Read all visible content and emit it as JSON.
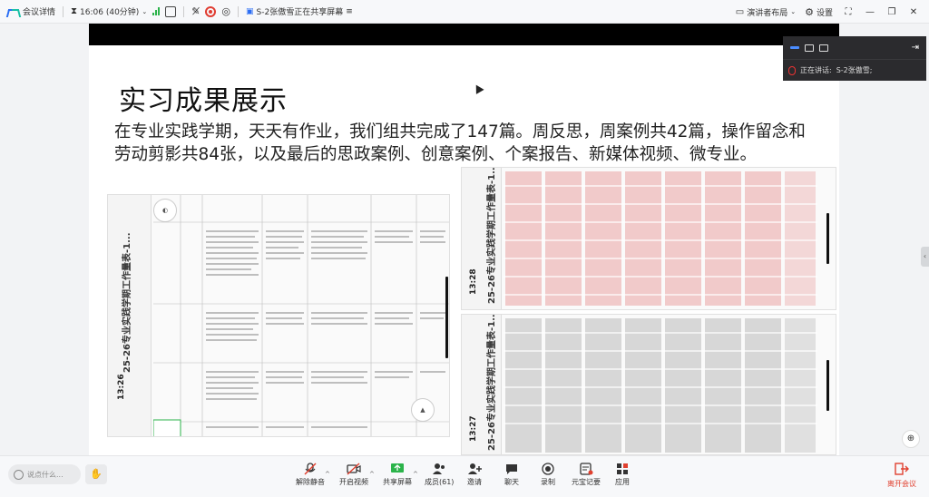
{
  "topbar": {
    "meeting_details": "会议详情",
    "time": "16:06 (40分钟)",
    "share_status": "S-2张傲雪正在共享屏幕",
    "presenter_layout": "演讲者布局",
    "settings": "设置"
  },
  "slide": {
    "title": "实习成果展示",
    "body": "在专业实践学期，天天有作业，我们组共完成了147篇。周反思，周案例共42篇，操作留念和劳动剪影共84张，以及最后的思政案例、创意案例、个案报告、新媒体视频、微专业。",
    "screenshot_left": {
      "title": "25-26专业实践学期工作量表-1...",
      "time": "13:26"
    },
    "screenshot_right_top": {
      "title": "25-26专业实践学期工作量表-1...",
      "time": "13:28"
    },
    "screenshot_right_bottom": {
      "title": "25-26专业实践学期工作量表-1...",
      "time": "13:27"
    }
  },
  "speaker": {
    "label": "正在讲话:",
    "name": "S-2张傲雪;"
  },
  "toolbar": {
    "chat_placeholder": "说点什么...",
    "items": [
      {
        "label": "解除静音",
        "icon": "mic-muted-icon"
      },
      {
        "label": "开启视频",
        "icon": "video-off-icon"
      },
      {
        "label": "共享屏幕",
        "icon": "share-screen-icon"
      },
      {
        "label": "成员(61)",
        "icon": "members-icon"
      },
      {
        "label": "邀请",
        "icon": "invite-icon"
      },
      {
        "label": "聊天",
        "icon": "chat-icon"
      },
      {
        "label": "录制",
        "icon": "record-icon"
      },
      {
        "label": "元宝记要",
        "icon": "summary-icon"
      },
      {
        "label": "应用",
        "icon": "apps-icon"
      }
    ],
    "leave": "离开会议"
  },
  "colors": {
    "brand_blue": "#2a6df4",
    "leave_red": "#e0402f",
    "signal_green": "#2bb34a"
  }
}
